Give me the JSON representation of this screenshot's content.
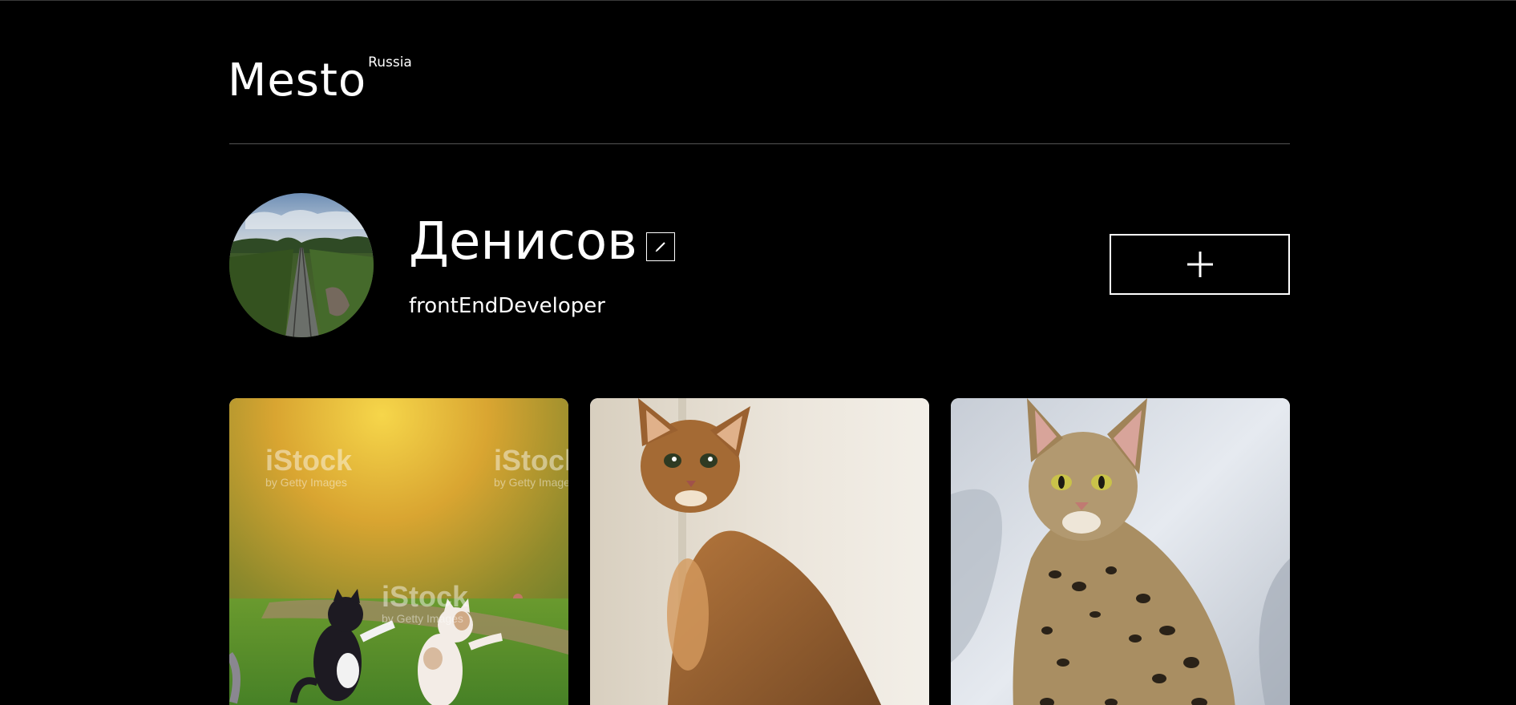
{
  "header": {
    "logo": "Mesto",
    "logo_sup": "Russia"
  },
  "profile": {
    "name": "Денисов",
    "job": "frontEndDeveloper",
    "avatar_alt": "railway-through-forest-icon",
    "edit_icon": "pencil-icon",
    "add_icon": "plus-icon"
  },
  "cards": [
    {
      "image_subject": "cats-dancing-on-lawn-image",
      "watermark": "iStock",
      "watermark_sub": "by Getty Images"
    },
    {
      "image_subject": "abyssinian-cat-image"
    },
    {
      "image_subject": "savannah-cat-image"
    }
  ],
  "colors": {
    "background": "#000000",
    "text": "#ffffff",
    "divider": "#545454"
  }
}
